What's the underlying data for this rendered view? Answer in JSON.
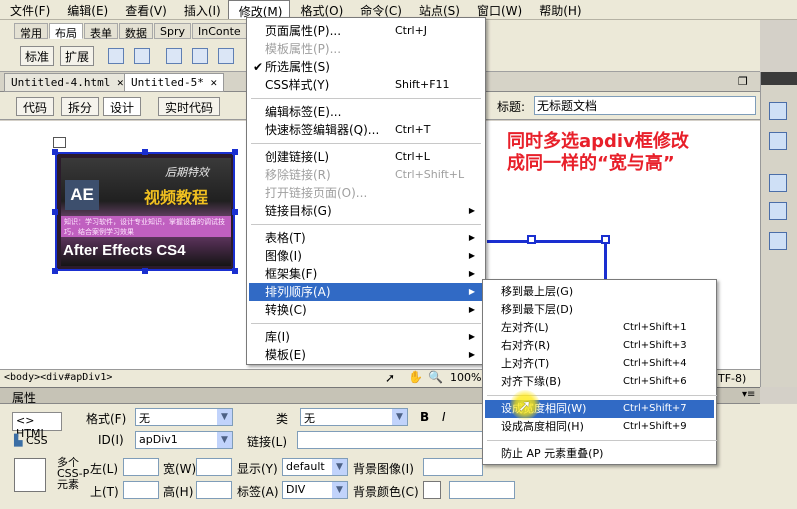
{
  "menubar": [
    "文件(F)",
    "编辑(E)",
    "查看(V)",
    "插入(I)",
    "修改(M)",
    "格式(O)",
    "命令(C)",
    "站点(S)",
    "窗口(W)",
    "帮助(H)"
  ],
  "insert_tabs": [
    "常用",
    "布局",
    "表单",
    "数据",
    "Spry",
    "InConte"
  ],
  "insert_buttons": {
    "standard": "标准",
    "expanded": "扩展"
  },
  "doc_tabs": [
    "Untitled-4.html",
    "Untitled-5*"
  ],
  "view": {
    "code": "代码",
    "split": "拆分",
    "design": "设计",
    "live_code": "实时代码",
    "title_label": "标题:",
    "title_value": "无标题文档"
  },
  "annotation": [
    "同时多选apdiv框修改",
    "成同一样的“宽与高”"
  ],
  "ae_image": {
    "series": "后期特效",
    "video": "视频教程",
    "logo": "AE",
    "desc": "知识：学习软件，设计专业知识，掌握设备的调试技巧，结合案例学习效果",
    "product": "After Effects CS4"
  },
  "status": {
    "tagpath": "<body><div#apDiv1>",
    "zoom": "100%",
    "encoding": "TF-8)"
  },
  "properties": {
    "title": "属性",
    "html_btn": "HTML",
    "css_btn": "CSS",
    "format_label": "格式(F)",
    "format_value": "无",
    "class_label": "类",
    "class_value": "无",
    "id_label": "ID(I)",
    "id_value": "apDiv1",
    "link_label": "链接(L)",
    "multi": [
      "多个",
      "CSS-P",
      "元素"
    ],
    "left_label": "左(L)",
    "top_label": "上(T)",
    "width_label": "宽(W)",
    "height_label": "高(H)",
    "display_label": "显示(Y)",
    "display_value": "default",
    "tag_label": "标签(A)",
    "tag_value": "DIV",
    "bgimage_label": "背景图像(I)",
    "bgcolor_label": "背景颜色(C)"
  },
  "modify_menu": [
    {
      "label": "页面属性(P)...",
      "sc": "Ctrl+J"
    },
    {
      "label": "模板属性(P)...",
      "disabled": true
    },
    {
      "label": "所选属性(S)",
      "checked": true
    },
    {
      "label": "CSS样式(Y)",
      "sc": "Shift+F11"
    },
    {
      "sep": true
    },
    {
      "label": "编辑标签(E)..."
    },
    {
      "label": "快速标签编辑器(Q)...",
      "sc": "Ctrl+T"
    },
    {
      "sep": true
    },
    {
      "label": "创建链接(L)",
      "sc": "Ctrl+L"
    },
    {
      "label": "移除链接(R)",
      "sc": "Ctrl+Shift+L",
      "disabled": true
    },
    {
      "label": "打开链接页面(O)...",
      "disabled": true
    },
    {
      "label": "链接目标(G)",
      "sub": true
    },
    {
      "sep": true
    },
    {
      "label": "表格(T)",
      "sub": true
    },
    {
      "label": "图像(I)",
      "sub": true
    },
    {
      "label": "框架集(F)",
      "sub": true
    },
    {
      "label": "排列顺序(A)",
      "sub": true,
      "hl": true
    },
    {
      "label": "转换(C)",
      "sub": true
    },
    {
      "sep": true
    },
    {
      "label": "库(I)",
      "sub": true
    },
    {
      "label": "模板(E)",
      "sub": true
    }
  ],
  "arrange_submenu": [
    {
      "label": "移到最上层(G)"
    },
    {
      "label": "移到最下层(D)"
    },
    {
      "label": "左对齐(L)",
      "sc": "Ctrl+Shift+1"
    },
    {
      "label": "右对齐(R)",
      "sc": "Ctrl+Shift+3"
    },
    {
      "label": "上对齐(T)",
      "sc": "Ctrl+Shift+4"
    },
    {
      "label": "对齐下缘(B)",
      "sc": "Ctrl+Shift+6"
    },
    {
      "sep": true
    },
    {
      "label": "设成宽度相同(W)",
      "sc": "Ctrl+Shift+7",
      "hl": true
    },
    {
      "label": "设成高度相同(H)",
      "sc": "Ctrl+Shift+9"
    },
    {
      "sep": true
    },
    {
      "label": "防止 AP 元素重叠(P)"
    }
  ]
}
